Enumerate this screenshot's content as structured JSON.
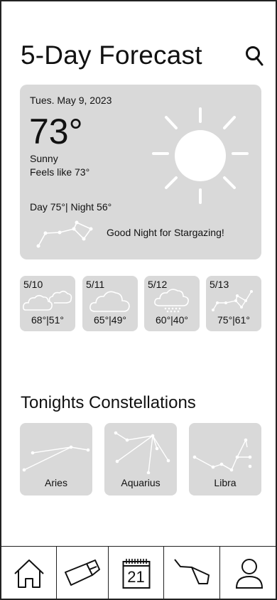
{
  "header": {
    "title": "5-Day Forecast",
    "search_icon": "search-icon"
  },
  "today": {
    "date": "Tues. May 9, 2023",
    "temperature": "73°",
    "condition": "Sunny",
    "feels_like": "Feels like 73°",
    "day_night": "Day 75°| Night 56°",
    "stargazing": "Good Night for Stargazing!",
    "icon": "sun-icon"
  },
  "forecast": [
    {
      "date": "5/10",
      "temps": "68°|51°",
      "icon": "cloudy-icon"
    },
    {
      "date": "5/11",
      "temps": "65°|49°",
      "icon": "cloud-icon"
    },
    {
      "date": "5/12",
      "temps": "60°|40°",
      "icon": "rain-cloud-icon"
    },
    {
      "date": "5/13",
      "temps": "75°|61°",
      "icon": "constellation-icon"
    }
  ],
  "constellations": {
    "title": "Tonights Constellations",
    "items": [
      {
        "name": "Aries"
      },
      {
        "name": "Aquarius"
      },
      {
        "name": "Libra"
      }
    ]
  },
  "nav": {
    "items": [
      {
        "icon": "home-icon"
      },
      {
        "icon": "telescope-icon"
      },
      {
        "icon": "calendar-icon",
        "label": "21"
      },
      {
        "icon": "constellation-icon"
      },
      {
        "icon": "profile-icon"
      }
    ]
  }
}
